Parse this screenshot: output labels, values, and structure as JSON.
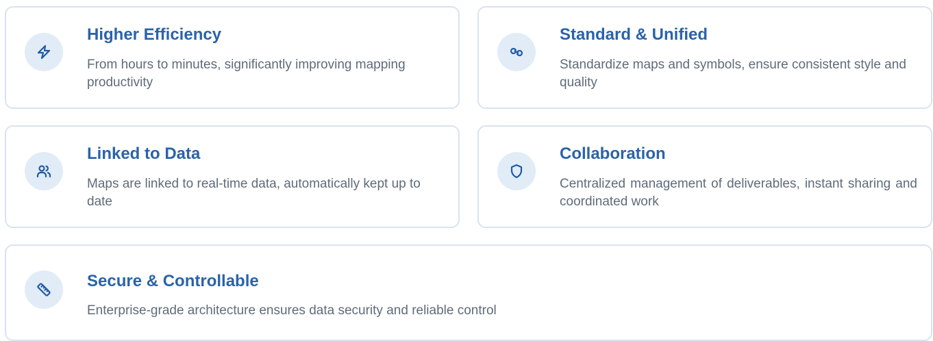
{
  "features": {
    "efficiency": {
      "icon": "lightning-icon",
      "title": "Higher Efficiency",
      "description": "From hours to minutes, significantly improving mapping productivity"
    },
    "standard": {
      "icon": "link-icon",
      "title": "Standard & Unified",
      "description": "Standardize maps and symbols, ensure consistent style and quality"
    },
    "linked": {
      "icon": "users-icon",
      "title": "Linked to Data",
      "description": "Maps are linked to real-time data, automatically kept up to date"
    },
    "collaboration": {
      "icon": "shield-icon",
      "title": "Collaboration",
      "description": "Centralized management of deliverables, instant sharing and coordinated work"
    },
    "secure": {
      "icon": "ruler-icon",
      "title": "Secure & Controllable",
      "description": "Enterprise-grade architecture ensures data security and reliable control"
    }
  },
  "colors": {
    "accent": "#2b63a8",
    "icon_bg": "#e1ecf7",
    "border": "#d9e3ef",
    "text": "#5f6b7a"
  }
}
